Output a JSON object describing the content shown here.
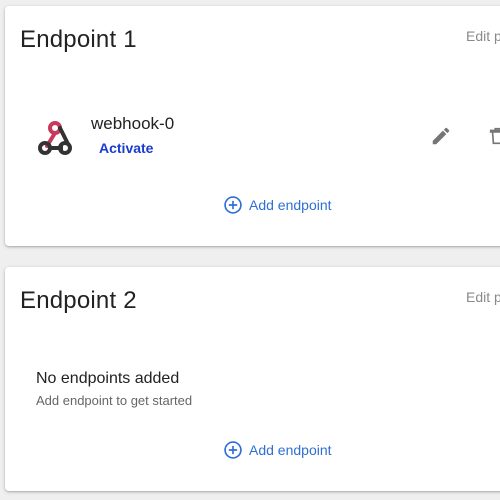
{
  "endpoints": [
    {
      "title": "Endpoint 1",
      "edit_label": "Edit p",
      "items": [
        {
          "name": "webhook-0",
          "action": "Activate",
          "icon": "webhook-icon"
        }
      ],
      "add_label": "Add endpoint"
    },
    {
      "title": "Endpoint 2",
      "edit_label": "Edit p",
      "empty_title": "No endpoints added",
      "empty_subtitle": "Add endpoint to get started",
      "add_label": "Add endpoint"
    }
  ],
  "colors": {
    "accent": "#2f6fd6",
    "activate": "#1a3bd0",
    "webhook_red": "#c73a5e",
    "webhook_dark": "#333333"
  }
}
